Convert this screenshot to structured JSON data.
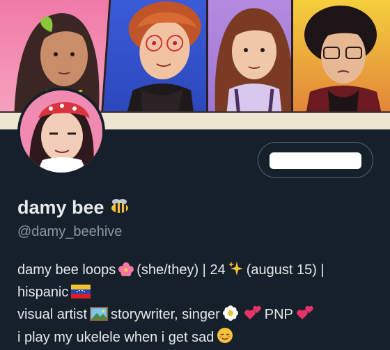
{
  "profile": {
    "display_name": "damy bee",
    "handle": "@damy_beehive",
    "bio": {
      "line1_a": "damy bee loops",
      "line1_b": "(she/they) | 24",
      "line1_c": "(august 15) |",
      "line2": "hispanic",
      "line3_a": "visual artist",
      "line3_b": "storywriter, singer",
      "line3_c": "PNP",
      "line4": "i play my ukelele when i get sad"
    }
  },
  "icons": {
    "name_emoji": "bee-icon",
    "flower": "hibiscus-icon",
    "sparkles": "sparkles-icon",
    "flag": "venezuela-flag-icon",
    "picture": "framed-picture-icon",
    "daisy": "daisy-icon",
    "hearts": "two-hearts-icon",
    "relieved": "relieved-face-icon"
  },
  "colors": {
    "background": "#15202b",
    "text_primary": "#e7e9ea",
    "text_secondary": "#8b98a5",
    "button_border": "#536471"
  }
}
